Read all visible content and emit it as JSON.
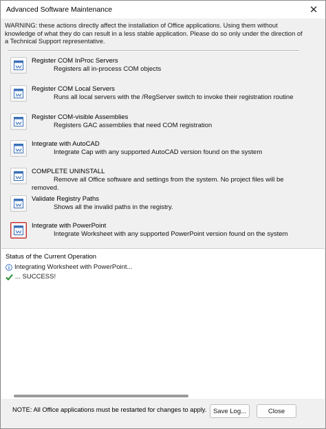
{
  "window": {
    "title": "Advanced Software Maintenance",
    "warning": "WARNING: these actions directly affect the installation of Office applications.  Using them without knowledge of what they do can result in a less stable application.  Please do so only under the direction of a Technical Support representative."
  },
  "actions": [
    {
      "title": "Register COM InProc Servers",
      "description": "Registers all in-process COM objects"
    },
    {
      "title": "Register COM Local Servers",
      "description": "Runs all local servers with the /RegServer switch to invoke their registration routine"
    },
    {
      "title": "Register COM-visible Assemblies",
      "description": "Registers GAC assemblies that need COM registration"
    },
    {
      "title": "Integrate with AutoCAD",
      "description": "Integrate Cap with any supported AutoCAD version found on the system"
    },
    {
      "title": "COMPLETE UNINSTALL",
      "description": "Remove all Office software and settings from the system. No project files will be removed."
    },
    {
      "title": "Validate Registry Paths",
      "description": "Shows all the invalid paths in the registry."
    },
    {
      "title": "Integrate with PowerPoint",
      "description": "Integrate Worksheet with any supported PowerPoint version found on the system"
    }
  ],
  "status": {
    "heading": "Status of the Current Operation",
    "lines": [
      {
        "icon": "info-icon",
        "text": "Integrating Worksheet with PowerPoint..."
      },
      {
        "icon": "checkmark-icon",
        "text": "... SUCCESS!"
      }
    ]
  },
  "footer": {
    "note": "NOTE: All Office applications must be restarted for changes to apply.",
    "save_log_label": "Save Log...",
    "close_label": "Close"
  },
  "colors": {
    "selected_border": "#c42b2b",
    "success_green": "#1e8c2b",
    "info_blue": "#2a6bc4"
  }
}
